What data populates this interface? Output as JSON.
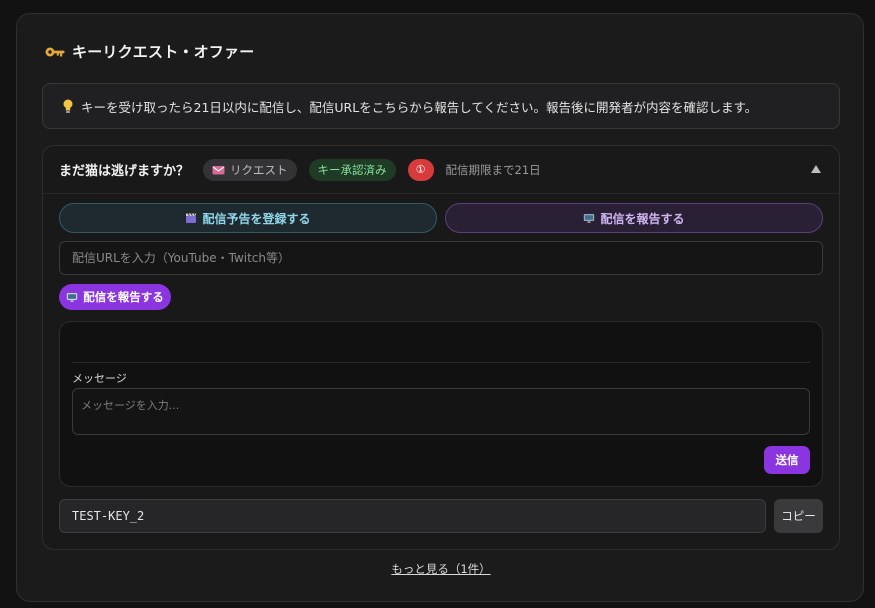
{
  "panel": {
    "title": "キーリクエスト・オファー",
    "title_icon": "key-icon"
  },
  "notice": {
    "icon": "lightbulb-icon",
    "text": "キーを受け取ったら21日以内に配信し、配信URLをこちらから報告してください。報告後に開発者が内容を確認します。"
  },
  "card": {
    "title": "まだ猫は逃げますか？",
    "request_pill": "リクエスト",
    "approved_pill": "キー承認済み",
    "count_badge": "①",
    "deadline": "配信期限まで21日",
    "schedule_button": "配信予告を登録する",
    "report_top_button": "配信を報告する",
    "url_placeholder": "配信URLを入力（YouTube・Twitch等）",
    "report_button": "配信を報告する",
    "message": {
      "label": "メッセージ",
      "placeholder": "メッセージを入力...",
      "send_button": "送信"
    },
    "key_value": "TEST-KEY_2",
    "copy_button": "コピー"
  },
  "more_link": "もっと見る（1件）",
  "colors": {
    "accent_purple": "#8b35e0",
    "approved_green": "#86e09a",
    "badge_red": "#d83b3b",
    "schedule_cyan": "#8fd6e8"
  }
}
